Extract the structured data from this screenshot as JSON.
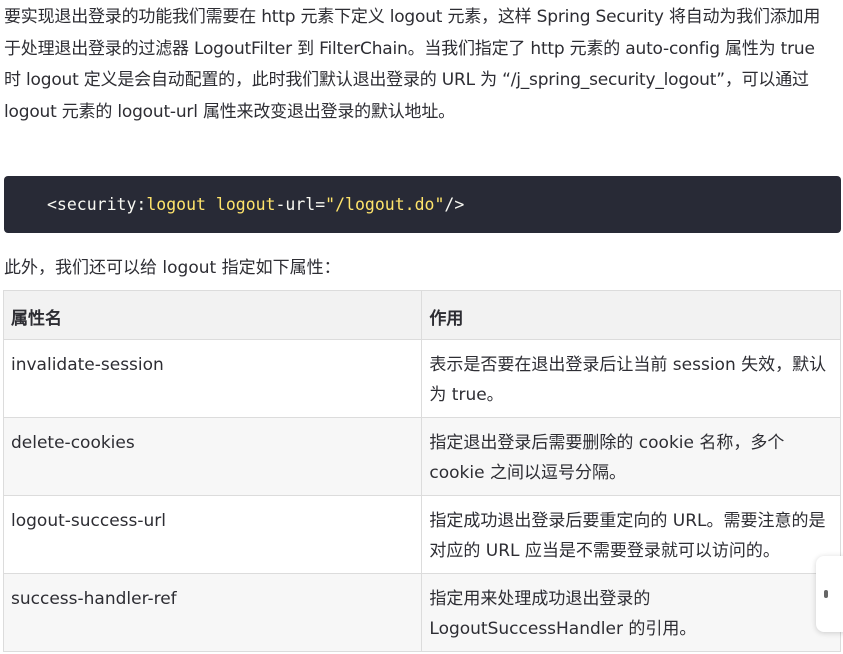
{
  "paragraph": "要实现退出登录的功能我们需要在 http 元素下定义 logout 元素，这样 Spring Security 将自动为我们添加用于处理退出登录的过滤器 LogoutFilter 到 FilterChain。当我们指定了 http 元素的 auto-config 属性为 true 时 logout 定义是会自动配置的，此时我们默认退出登录的 URL 为 “/j_spring_security_logout”，可以通过 logout 元素的 logout-url 属性来改变退出登录的默认地址。",
  "code": {
    "open": "<security:",
    "element": "logout",
    "space": " ",
    "attr_name": "logout",
    "attr_sep": "-url=",
    "attr_value": "\"/logout.do\"",
    "close": "/>"
  },
  "intro": "此外，我们还可以给 logout 指定如下属性：",
  "table": {
    "headers": [
      "属性名",
      "作用"
    ],
    "rows": [
      {
        "name": "invalidate-session",
        "desc": "表示是否要在退出登录后让当前 session 失效，默认为 true。"
      },
      {
        "name": "delete-cookies",
        "desc": "指定退出登录后需要删除的 cookie 名称，多个 cookie 之间以逗号分隔。"
      },
      {
        "name": "logout-success-url",
        "desc": "指定成功退出登录后要重定向的 URL。需要注意的是对应的 URL 应当是不需要登录就可以访问的。"
      },
      {
        "name": "success-handler-ref",
        "desc": "指定用来处理成功退出登录的 LogoutSuccessHandler 的引用。"
      }
    ]
  },
  "colors": {
    "code_bg": "#282a36",
    "code_highlight": "#ffe46b",
    "header_bg": "#f2f2f2",
    "border": "#dcdcdc"
  }
}
